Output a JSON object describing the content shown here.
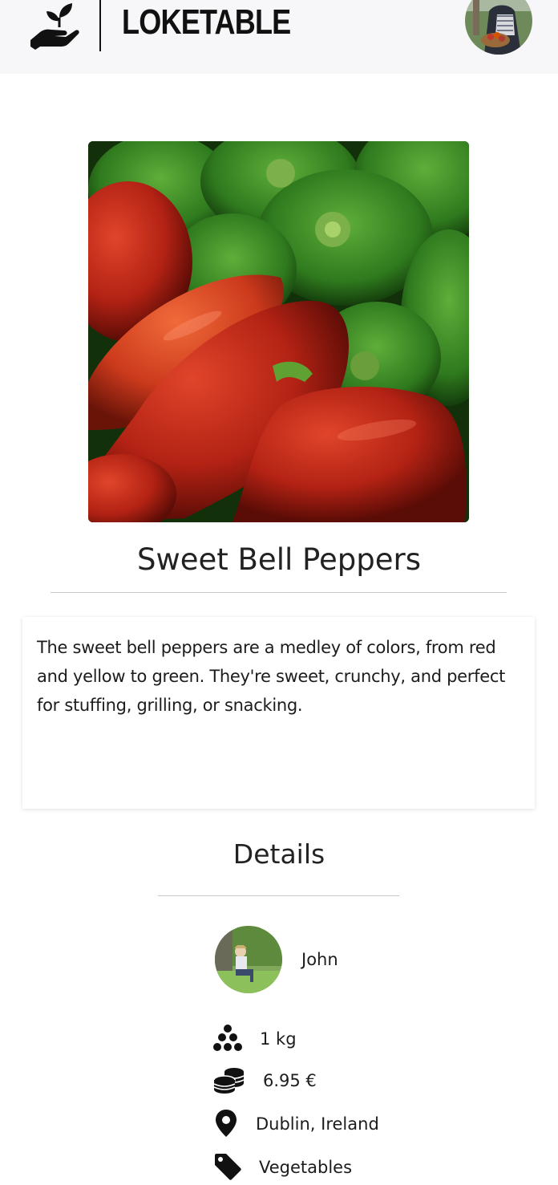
{
  "header": {
    "brand": "LOKETABLE",
    "logo_icon": "hand-sprout-icon",
    "avatar_icon": "user-avatar"
  },
  "product": {
    "image_alt": "bell-peppers-photo",
    "title": "Sweet Bell Peppers",
    "description": "The sweet bell peppers are a medley of colors, from red and yellow to green. They're sweet, crunchy, and perfect for stuffing, grilling, or snacking."
  },
  "details": {
    "heading": "Details",
    "seller": {
      "name": "John"
    },
    "quantity": {
      "icon": "boxes-icon",
      "value": "1 kg"
    },
    "price": {
      "icon": "coins-icon",
      "value": "6.95 €"
    },
    "location": {
      "icon": "map-pin-icon",
      "value": "Dublin, Ireland"
    },
    "category": {
      "icon": "tag-icon",
      "value": "Vegetables"
    }
  },
  "colors": {
    "header_bg": "#f7f7f9",
    "text": "#222222",
    "rule": "#c8c8c8"
  }
}
